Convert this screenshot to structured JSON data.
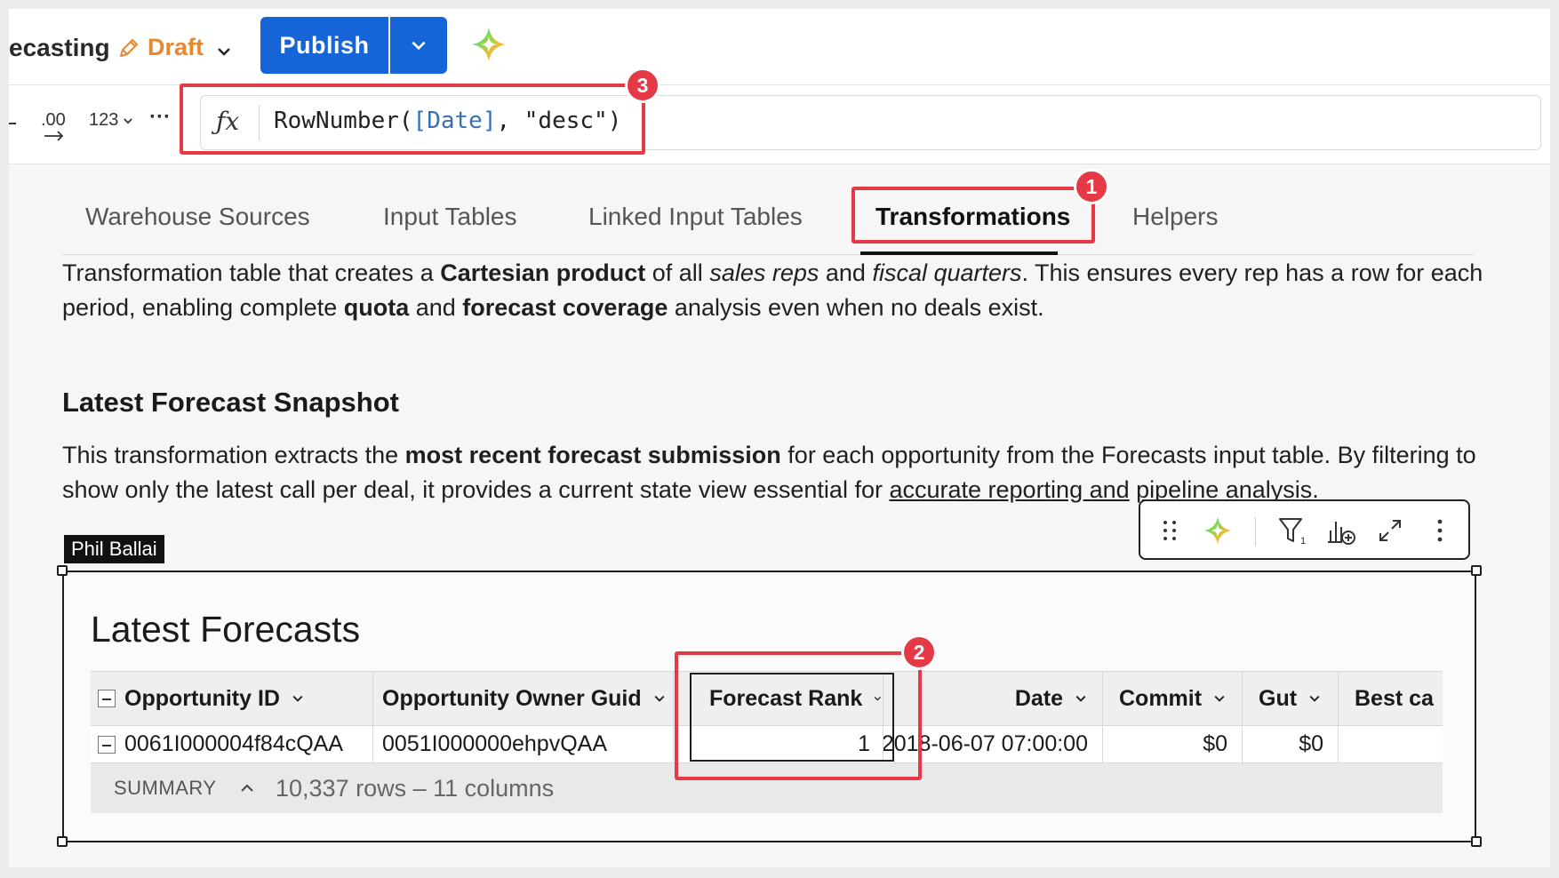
{
  "header": {
    "workbook_name": "ecasting",
    "status": "Draft",
    "publish_label": "Publish"
  },
  "toolbar": {
    "decimal_label": ".00",
    "number_format_label": "123",
    "more_label": "···",
    "formula": {
      "prefix": "RowNumber(",
      "column": "[Date]",
      "suffix": ", \"desc\")"
    }
  },
  "tabs": [
    {
      "label": "Warehouse Sources",
      "active": false
    },
    {
      "label": "Input Tables",
      "active": false
    },
    {
      "label": "Linked Input Tables",
      "active": false
    },
    {
      "label": "Transformations",
      "active": true
    },
    {
      "label": "Helpers",
      "active": false
    }
  ],
  "intro": {
    "t1": "Transformation table that creates a ",
    "b1": "Cartesian product",
    "t2": " of all ",
    "i1": "sales reps",
    "t3": " and ",
    "i2": "fiscal quarters",
    "t4": ". This ensures every rep has a row for each period, enabling complete ",
    "b2": "quota",
    "t5": " and ",
    "b3": "forecast coverage",
    "t6": " analysis even when no deals exist."
  },
  "section": {
    "title": "Latest Forecast Snapshot",
    "t1": "This transformation extracts the ",
    "b1": "most recent forecast submission",
    "t2": " for each opportunity from the Forecasts input table. By filtering to show only the latest call per deal, it provides a current state view essential for ",
    "u1": "accurate reporting and",
    "t3": " ",
    "u2": "pipeline",
    "t4": " analysis."
  },
  "presence_user": "Phil Ballai",
  "table": {
    "title": "Latest Forecasts",
    "columns": [
      "Opportunity ID",
      "Opportunity Owner Guid",
      "Forecast Rank",
      "Date",
      "Commit",
      "Gut",
      "Best ca"
    ],
    "row": [
      "0061I000004f84cQAA",
      "0051I000000ehpvQAA",
      "1",
      "2018-06-07 07:00:00",
      "$0",
      "$0",
      ""
    ],
    "summary_label": "SUMMARY",
    "summary_text": "10,337 rows – 11 columns"
  },
  "callouts": [
    "1",
    "2",
    "3"
  ],
  "colors": {
    "accent": "#1565d8",
    "draft": "#e8872d",
    "callout": "#e63946"
  }
}
